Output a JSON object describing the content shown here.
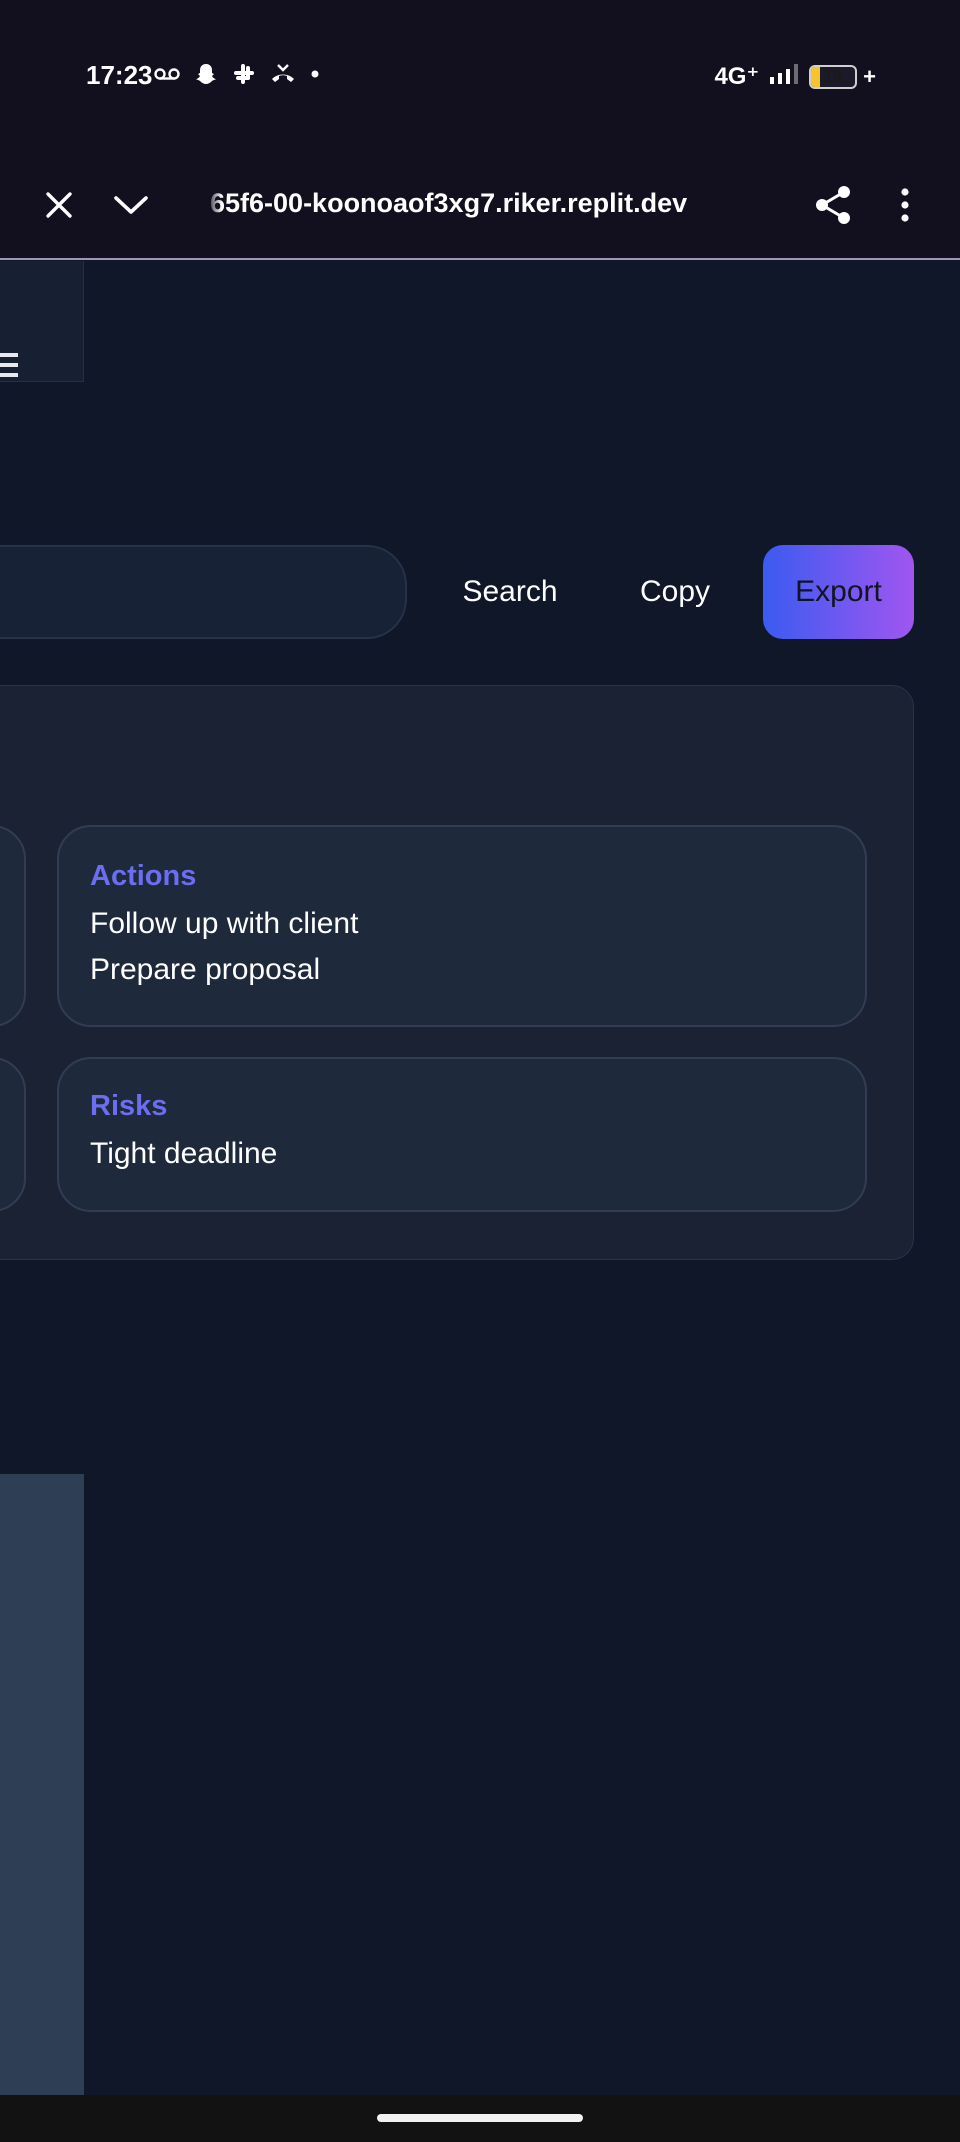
{
  "status_bar": {
    "time": "17:23",
    "left_icons": [
      "voicemail-icon",
      "snapchat-icon",
      "slack-icon",
      "missed-call-icon",
      "dot-icon"
    ],
    "network": "4G⁺",
    "battery_level": "19",
    "battery_charging": "+"
  },
  "browser": {
    "url": "65f6-00-koonoaof3xg7.riker.replit.dev",
    "icons": [
      "close-icon",
      "chevron-down-icon",
      "share-icon",
      "more-vert-icon"
    ]
  },
  "toolbar": {
    "search_label": "Search",
    "copy_label": "Copy",
    "export_label": "Export"
  },
  "cards": {
    "actions": {
      "title": "Actions",
      "items": [
        "Follow up with client",
        "Prepare proposal"
      ]
    },
    "risks": {
      "title": "Risks",
      "items": [
        "Tight deadline"
      ]
    }
  },
  "colors": {
    "background": "#0f1729",
    "accent": "#6b6ef0",
    "export_gradient_start": "#3b5bf0",
    "export_gradient_end": "#a056f0"
  }
}
